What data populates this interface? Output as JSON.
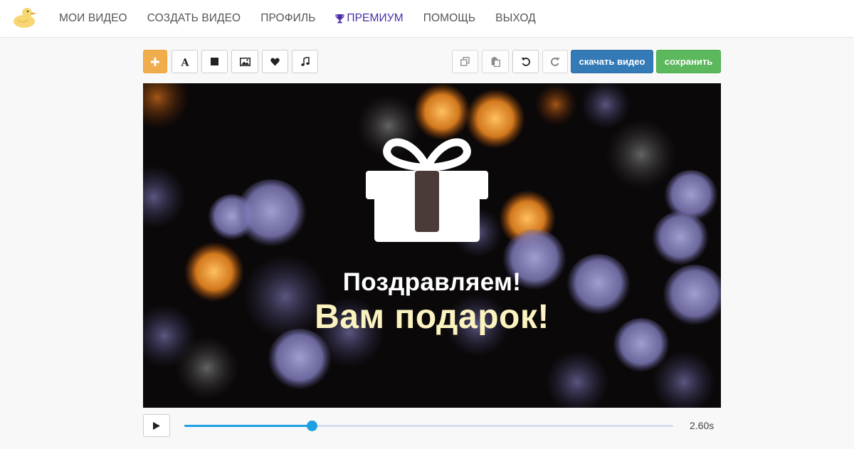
{
  "nav": {
    "items": [
      {
        "label": "МОИ ВИДЕО"
      },
      {
        "label": "СОЗДАТЬ ВИДЕО"
      },
      {
        "label": "ПРОФИЛЬ"
      },
      {
        "label": "ПРЕМИУМ"
      },
      {
        "label": "ПОМОЩЬ"
      },
      {
        "label": "ВЫХОД"
      }
    ],
    "premium_color": "#4b2ea8"
  },
  "toolbar": {
    "tools": [
      "plus-icon",
      "text-icon",
      "square-icon",
      "image-icon",
      "heart-icon",
      "music-icon"
    ],
    "history": [
      "copy-icon",
      "paste-icon",
      "undo-icon",
      "redo-icon"
    ],
    "download_label": "скачать видео",
    "save_label": "сохранить",
    "colors": {
      "add": "#f0ad4e",
      "download": "#337ab7",
      "save": "#5cb85c"
    }
  },
  "canvas": {
    "line1": "Поздравляем!",
    "line2": "Вам подарок!",
    "line2_color": "#fbf3bf",
    "icon": "gift-icon"
  },
  "player": {
    "time": "2.60s",
    "progress": 0.26,
    "accent": "#1ba1e2"
  }
}
